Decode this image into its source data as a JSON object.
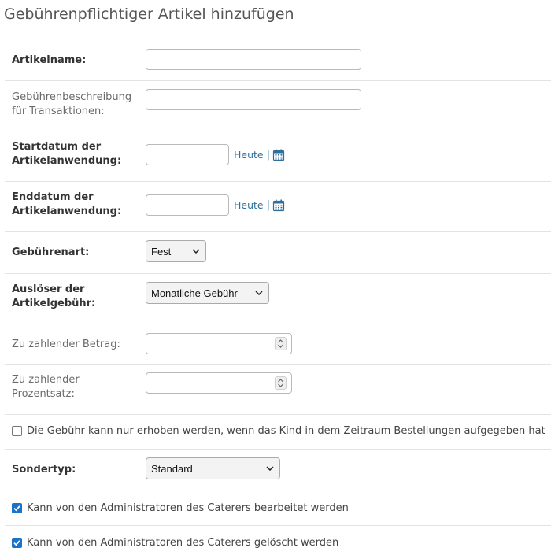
{
  "page": {
    "title": "Gebührenpflichtiger Artikel hinzufügen"
  },
  "fields": {
    "article_name": {
      "label": "Artikelname:",
      "value": ""
    },
    "fee_description": {
      "label_line1": "Gebührenbeschreibung",
      "label_line2": "für Transaktionen:",
      "value": ""
    },
    "start_date": {
      "label_line1": "Startdatum der",
      "label_line2": "Artikelanwendung:",
      "value": "",
      "today_link": "Heute",
      "separator": "|",
      "icon": "calendar-icon"
    },
    "end_date": {
      "label_line1": "Enddatum der",
      "label_line2": "Artikelanwendung:",
      "value": "",
      "today_link": "Heute",
      "separator": "|",
      "icon": "calendar-icon"
    },
    "fee_type": {
      "label": "Gebührenart:",
      "selected": "Fest"
    },
    "fee_trigger": {
      "label_line1": "Auslöser der",
      "label_line2": "Artikelgebühr:",
      "selected": "Monatliche Gebühr"
    },
    "amount": {
      "label": "Zu zahlender Betrag:",
      "value": ""
    },
    "percentage": {
      "label_line1": "Zu zahlender",
      "label_line2": "Prozentsatz:",
      "value": ""
    },
    "only_if_orders": {
      "label": "Die Gebühr kann nur erhoben werden, wenn das Kind in dem Zeitraum Bestellungen aufgegeben hat",
      "checked": false
    },
    "special_type": {
      "label": "Sondertyp:",
      "selected": "Standard"
    },
    "editable_by_admins": {
      "label": "Kann von den Administratoren des Caterers bearbeitet werden",
      "checked": true
    },
    "deletable_by_admins": {
      "label": "Kann von den Administratoren des Caterers gelöscht werden",
      "checked": true
    }
  },
  "colors": {
    "link": "#2f6f9a",
    "checkbox_checked": "#1a73c8",
    "row_divider": "#e3e3e3"
  }
}
